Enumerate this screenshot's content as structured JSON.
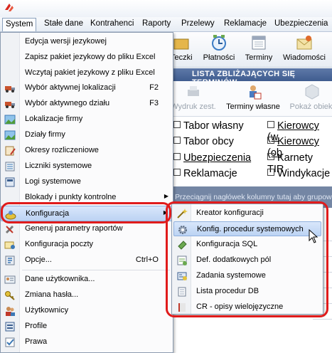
{
  "menubar": {
    "items": [
      "System",
      "Stałe dane",
      "Kontrahenci",
      "Raporty",
      "Przelewy",
      "Reklamacje",
      "Ubezpieczenia"
    ]
  },
  "toolbar": {
    "buttons": [
      "Teczki",
      "Płatności",
      "Terminy",
      "Wiadomości"
    ]
  },
  "panel": {
    "title": "LISTA ZBLIŻAJĄCYCH SIĘ TERMINÓW",
    "buttons": [
      "Wydruk zest.",
      "Terminy własne",
      "Pokaż obiekt"
    ],
    "checkboxes": [
      "Tabor własny",
      "Tabor obcy",
      "Ubezpieczenia",
      "Reklamacje",
      "Kierowcy (w",
      "Kierowcy (ob",
      "Karnety TIR",
      "Windykacje"
    ],
    "group_hint": "Przeciągnij nagłówek kolumny tutaj aby grupować"
  },
  "system_menu": {
    "items": [
      {
        "label": "Edycja wersji jezykowej",
        "icon": "none"
      },
      {
        "label": "Zapisz pakiet jezykowy do pliku Excel",
        "icon": "none"
      },
      {
        "label": "Wczytaj pakiet jezykowy z pliku Excel",
        "icon": "none"
      },
      {
        "label": "Wybór aktywnej lokalizacji",
        "shortcut": "F2",
        "icon": "truck-icon"
      },
      {
        "label": "Wybór aktywnego działu",
        "shortcut": "F3",
        "icon": "truck-icon"
      },
      {
        "label": "Lokalizacje firmy",
        "icon": "landscape-icon"
      },
      {
        "label": "Działy firmy",
        "icon": "landscape-icon"
      },
      {
        "label": "Okresy rozliczeniowe",
        "icon": "calendar-edit-icon"
      },
      {
        "label": "Liczniki systemowe",
        "icon": "counter-icon"
      },
      {
        "label": "Logi systemowe",
        "icon": "log-icon"
      },
      {
        "label": "Blokady i punkty kontrolne",
        "icon": "none"
      },
      {
        "label": "Konfiguracja",
        "icon": "config-icon"
      },
      {
        "label": "Generuj parametry raportów",
        "icon": "tools-icon"
      },
      {
        "label": "Konfiguracja poczty",
        "icon": "mail-config-icon"
      },
      {
        "label": "Opcje...",
        "shortcut": "Ctrl+O",
        "icon": "options-icon"
      },
      {
        "label": "Dane użytkownika...",
        "icon": "user-card-icon"
      },
      {
        "label": "Zmiana hasła...",
        "icon": "key-icon"
      },
      {
        "label": "Użytkownicy",
        "icon": "users-icon"
      },
      {
        "label": "Profile",
        "icon": "profile-icon"
      },
      {
        "label": "Prawa",
        "icon": "rights-icon"
      }
    ]
  },
  "config_submenu": {
    "items": [
      {
        "label": "Kreator konfiguracji",
        "icon": "wand-icon"
      },
      {
        "label": "Konfig. procedur systemowych",
        "icon": "gear-icon"
      },
      {
        "label": "Konfiguracja SQL",
        "icon": "sql-icon"
      },
      {
        "label": "Def. dodatkowych pól",
        "icon": "fields-icon"
      },
      {
        "label": "Zadania systemowe",
        "icon": "tasks-icon"
      },
      {
        "label": "Lista procedur DB",
        "icon": "list-icon"
      },
      {
        "label": "CR - opisy wielojęzyczne",
        "icon": "book-icon"
      }
    ]
  },
  "colors": {
    "accent": "#e01b1b",
    "highlight": "#bcd3f3",
    "band": "#3f5c8f"
  }
}
